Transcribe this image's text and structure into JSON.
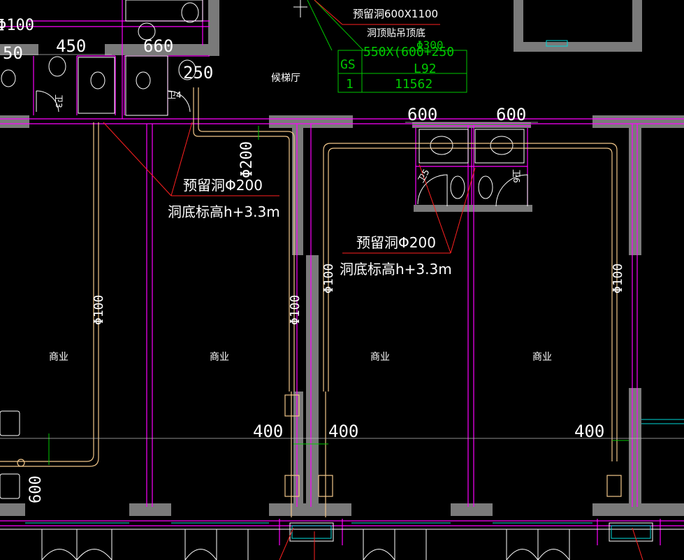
{
  "colors": {
    "wall": "#7a7a7a",
    "wall_line": "#ff00ff",
    "pipe": "#f2c78a",
    "leader": "#ff2020",
    "table": "#00c800",
    "fixture": "#ffffff",
    "door": "#ffffff"
  },
  "rooms": [
    {
      "label": "商业"
    },
    {
      "label": "商业"
    },
    {
      "label": "商业"
    },
    {
      "label": "商业"
    },
    {
      "label": "候梯厅"
    },
    {
      "label": "卫3"
    },
    {
      "label": "卫4"
    },
    {
      "label": "卫5"
    },
    {
      "label": "卫6"
    }
  ],
  "dimensions": [
    {
      "text": "Φ100"
    },
    {
      "text": "450"
    },
    {
      "text": "660"
    },
    {
      "text": "250"
    },
    {
      "text": "50"
    },
    {
      "text": "600"
    },
    {
      "text": "600"
    },
    {
      "text": "Φ200"
    },
    {
      "text": "Φ100"
    },
    {
      "text": "Φ100"
    },
    {
      "text": "Φ100"
    },
    {
      "text": "Φ100"
    },
    {
      "text": "400"
    },
    {
      "text": "400"
    },
    {
      "text": "400"
    },
    {
      "text": "600"
    }
  ],
  "notes": [
    {
      "text": "预留洞600X1100"
    },
    {
      "text": "洞顶贴吊顶底"
    },
    {
      "text": "预留洞Φ200"
    },
    {
      "text": "洞底标高h+3.3m"
    },
    {
      "text": "预留洞Φ200"
    },
    {
      "text": "洞底标高h+3.3m"
    }
  ],
  "table": {
    "header": [
      "GS",
      "550X(600+250",
      "L92"
    ],
    "row": [
      "1",
      "11562"
    ],
    "extra": "Φ300"
  }
}
